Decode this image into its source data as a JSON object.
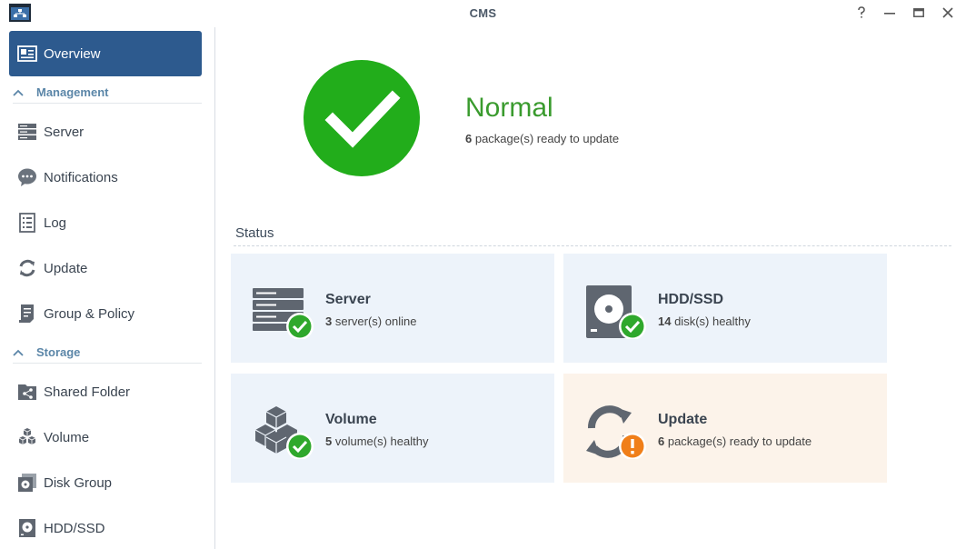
{
  "window": {
    "title": "CMS"
  },
  "titlebar": {
    "icons": [
      "app-icon",
      "help-icon",
      "minimize-icon",
      "maximize-icon",
      "close-icon"
    ]
  },
  "sidebar": {
    "overview": {
      "label": "Overview",
      "icon": "overview-icon"
    },
    "sections": [
      {
        "label": "Management",
        "items": [
          {
            "label": "Server",
            "icon": "server-icon"
          },
          {
            "label": "Notifications",
            "icon": "chat-bubble-icon"
          },
          {
            "label": "Log",
            "icon": "log-list-icon"
          },
          {
            "label": "Update",
            "icon": "refresh-icon"
          },
          {
            "label": "Group & Policy",
            "icon": "policy-document-icon"
          }
        ]
      },
      {
        "label": "Storage",
        "items": [
          {
            "label": "Shared Folder",
            "icon": "shared-folder-icon"
          },
          {
            "label": "Volume",
            "icon": "cubes-icon"
          },
          {
            "label": "Disk Group",
            "icon": "disk-group-icon"
          },
          {
            "label": "HDD/SSD",
            "icon": "hdd-icon"
          }
        ]
      }
    ]
  },
  "summary": {
    "status": "Normal",
    "count": "6",
    "text": " package(s) ready to update"
  },
  "status": {
    "heading": "Status",
    "cards": [
      {
        "title": "Server",
        "count": "3",
        "text": " server(s) online",
        "icon": "server-ok-icon",
        "state": "ok"
      },
      {
        "title": "HDD/SSD",
        "count": "14",
        "text": " disk(s) healthy",
        "icon": "hdd-ok-icon",
        "state": "ok"
      },
      {
        "title": "Volume",
        "count": "5",
        "text": " volume(s) healthy",
        "icon": "volume-ok-icon",
        "state": "ok"
      },
      {
        "title": "Update",
        "count": "6",
        "text": " package(s) ready to update",
        "icon": "update-warning-icon",
        "state": "warning"
      }
    ]
  },
  "colors": {
    "accent": "#2d5a8e",
    "ok": "#2fa82c",
    "warning": "#f07f1a",
    "normal_text": "#3a9b2e"
  }
}
